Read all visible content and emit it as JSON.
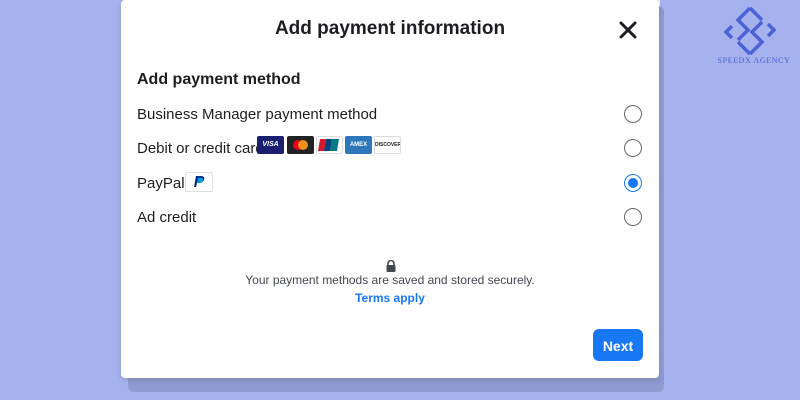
{
  "background": {
    "color": "#a5b2ee"
  },
  "modal": {
    "title": "Add payment information",
    "section_title": "Add payment method",
    "options": [
      {
        "label": "Business Manager payment method",
        "checked": false
      },
      {
        "label": "Debit or credit card",
        "checked": false
      },
      {
        "label": "PayPal",
        "checked": true
      },
      {
        "label": "Ad credit",
        "checked": false
      }
    ],
    "card_logos": [
      {
        "name": "VISA",
        "color": "#1a1f71"
      },
      {
        "name": "MC",
        "color": "#222222"
      },
      {
        "name": "UnionPay",
        "color": "#d7192d"
      },
      {
        "name": "AMEX",
        "color": "#2e77bb"
      },
      {
        "name": "DISCOVER",
        "color": "#ffffff"
      }
    ],
    "secure_text": "Your payment methods are saved and stored securely.",
    "terms_link": "Terms apply",
    "next_button": "Next",
    "accent_color": "#1877f2"
  },
  "watermark": {
    "brand": "SPEEDX AGENCY",
    "icon": "speedx-logo-icon",
    "color": "#4a62d6"
  }
}
